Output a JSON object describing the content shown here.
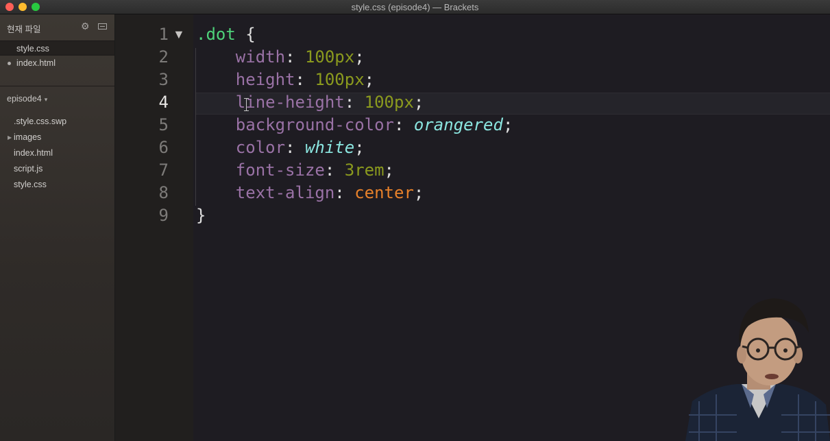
{
  "window": {
    "title": "style.css (episode4) — Brackets"
  },
  "sidebar": {
    "working_files_header": "현재 파일",
    "working_files": [
      {
        "label": "style.css",
        "selected": true,
        "dirty": false
      },
      {
        "label": "index.html",
        "selected": false,
        "dirty": true
      }
    ],
    "project_name": "episode4",
    "project_caret": "▾",
    "tree": [
      {
        "label": ".style.css.swp",
        "folder": false
      },
      {
        "label": "images",
        "folder": true
      },
      {
        "label": "index.html",
        "folder": false
      },
      {
        "label": "script.js",
        "folder": false
      },
      {
        "label": "style.css",
        "folder": false
      }
    ]
  },
  "editor": {
    "current_line": 4,
    "line_numbers": [
      "1",
      "2",
      "3",
      "4",
      "5",
      "6",
      "7",
      "8",
      "9"
    ],
    "lines": [
      {
        "tokens": [
          {
            "t": ".dot",
            "c": "sel-c"
          },
          {
            "t": " {",
            "c": "punc"
          }
        ]
      },
      {
        "tokens": [
          {
            "t": "    width",
            "c": "prop"
          },
          {
            "t": ": ",
            "c": "punc"
          },
          {
            "t": "100px",
            "c": "num"
          },
          {
            "t": ";",
            "c": "punc"
          }
        ]
      },
      {
        "tokens": [
          {
            "t": "    height",
            "c": "prop"
          },
          {
            "t": ": ",
            "c": "punc"
          },
          {
            "t": "100px",
            "c": "num"
          },
          {
            "t": ";",
            "c": "punc"
          }
        ]
      },
      {
        "tokens": [
          {
            "t": "    line-height",
            "c": "prop"
          },
          {
            "t": ": ",
            "c": "punc"
          },
          {
            "t": "100px",
            "c": "num"
          },
          {
            "t": ";",
            "c": "punc"
          }
        ]
      },
      {
        "tokens": [
          {
            "t": "    background-color",
            "c": "prop"
          },
          {
            "t": ": ",
            "c": "punc"
          },
          {
            "t": "orangered",
            "c": "kw"
          },
          {
            "t": ";",
            "c": "punc"
          }
        ]
      },
      {
        "tokens": [
          {
            "t": "    color",
            "c": "prop"
          },
          {
            "t": ": ",
            "c": "punc"
          },
          {
            "t": "white",
            "c": "kw"
          },
          {
            "t": ";",
            "c": "punc"
          }
        ]
      },
      {
        "tokens": [
          {
            "t": "    font-size",
            "c": "prop"
          },
          {
            "t": ": ",
            "c": "punc"
          },
          {
            "t": "3rem",
            "c": "num"
          },
          {
            "t": ";",
            "c": "punc"
          }
        ]
      },
      {
        "tokens": [
          {
            "t": "    text-align",
            "c": "prop"
          },
          {
            "t": ": ",
            "c": "punc"
          },
          {
            "t": "center",
            "c": "val"
          },
          {
            "t": ";",
            "c": "punc"
          }
        ]
      },
      {
        "tokens": [
          {
            "t": "}",
            "c": "punc"
          }
        ]
      }
    ]
  },
  "colors": {
    "selector": "#4ed27a",
    "property": "#9a72a6",
    "number": "#8b9a1e",
    "keyword": "#8be6e0",
    "value": "#e8812a"
  }
}
